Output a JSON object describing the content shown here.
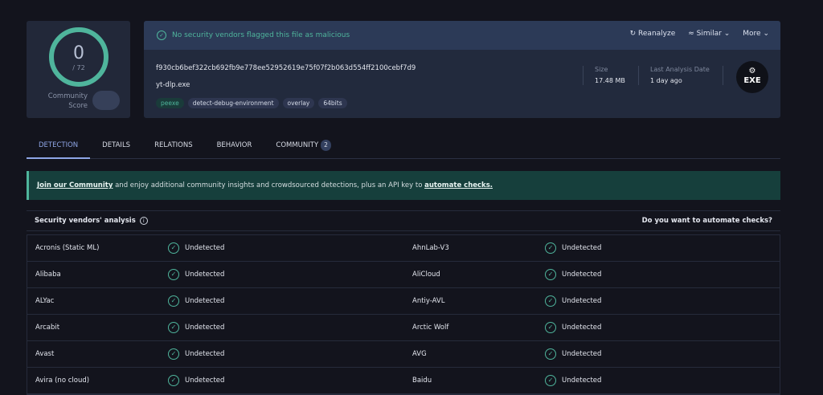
{
  "score": {
    "value": "0",
    "total": "/ 72",
    "label_line1": "Community",
    "label_line2": "Score",
    "ring_color": "#4fb59c"
  },
  "status": {
    "message": "No security vendors flagged this file as malicious",
    "color": "#4fb59c"
  },
  "actions": {
    "reanalyze": "Reanalyze",
    "similar": "Similar",
    "more": "More"
  },
  "file": {
    "hash": "f930cb6bef322cb692fb9e778ee52952619e75f07f2b063d554ff2100cebf7d9",
    "name": "yt-dlp.exe",
    "tags": [
      "peexe",
      "detect-debug-environment",
      "overlay",
      "64bits"
    ],
    "size_label": "Size",
    "size": "17.48 MB",
    "date_label": "Last Analysis Date",
    "date": "1 day ago",
    "type_icon": "EXE"
  },
  "tabs": [
    {
      "label": "DETECTION"
    },
    {
      "label": "DETAILS"
    },
    {
      "label": "RELATIONS"
    },
    {
      "label": "BEHAVIOR"
    },
    {
      "label": "COMMUNITY",
      "badge": "2"
    }
  ],
  "banner": {
    "link1": "Join our Community",
    "text": " and enjoy additional community insights and crowdsourced detections, plus an API key to ",
    "link2": "automate checks."
  },
  "table": {
    "title": "Security vendors' analysis",
    "automate": "Do you want to automate checks?",
    "rows": [
      {
        "v1": "Acronis (Static ML)",
        "r1": "Undetected",
        "v2": "AhnLab-V3",
        "r2": "Undetected"
      },
      {
        "v1": "Alibaba",
        "r1": "Undetected",
        "v2": "AliCloud",
        "r2": "Undetected"
      },
      {
        "v1": "ALYac",
        "r1": "Undetected",
        "v2": "Antiy-AVL",
        "r2": "Undetected"
      },
      {
        "v1": "Arcabit",
        "r1": "Undetected",
        "v2": "Arctic Wolf",
        "r2": "Undetected"
      },
      {
        "v1": "Avast",
        "r1": "Undetected",
        "v2": "AVG",
        "r2": "Undetected"
      },
      {
        "v1": "Avira (no cloud)",
        "r1": "Undetected",
        "v2": "Baidu",
        "r2": "Undetected"
      }
    ]
  }
}
